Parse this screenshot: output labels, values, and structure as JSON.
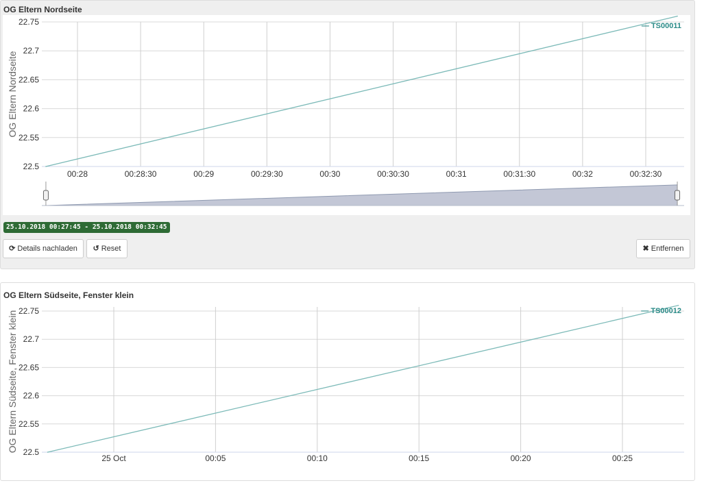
{
  "panels": [
    {
      "title": "OG Eltern Nordseite",
      "range_label": "25.10.2018 00:27:45 - 25.10.2018 00:32:45",
      "buttons": {
        "reload": "Details nachladen",
        "reset": "Reset",
        "remove": "Entfernen"
      }
    },
    {
      "title": "OG Eltern Südseite, Fenster klein"
    }
  ],
  "icons": {
    "reload": "refresh-icon",
    "reset": "undo-icon",
    "remove": "close-icon"
  },
  "colors": {
    "series": "#7cbab8",
    "legend": "#2a8a87",
    "badge": "#2e6b35"
  },
  "chart_data": [
    {
      "type": "line",
      "title": "",
      "ylabel": "OG Eltern Nordseite",
      "xlabel": "",
      "x_ticks": [
        "00:28",
        "00:28:30",
        "00:29",
        "00:29:30",
        "00:30",
        "00:30:30",
        "00:31",
        "00:31:30",
        "00:32",
        "00:32:30"
      ],
      "y_ticks": [
        "22.5",
        "22.55",
        "22.6",
        "22.65",
        "22.7",
        "22.75"
      ],
      "ylim": [
        22.5,
        22.75
      ],
      "legend_position": "top-right",
      "navigator": true,
      "series": [
        {
          "name": "TS00011",
          "x": [
            "00:27:45",
            "00:32:45"
          ],
          "values": [
            22.5,
            22.76
          ]
        }
      ]
    },
    {
      "type": "line",
      "title": "",
      "ylabel": "OG Eltern Südseite, Fenster klein",
      "xlabel": "",
      "x_ticks": [
        "25 Oct",
        "00:05",
        "00:10",
        "00:15",
        "00:20",
        "00:25"
      ],
      "y_ticks": [
        "22.5",
        "22.55",
        "22.6",
        "22.65",
        "22.7",
        "22.75"
      ],
      "ylim": [
        22.5,
        22.75
      ],
      "legend_position": "top-right",
      "series": [
        {
          "name": "TS00012",
          "x": [
            "24 Oct 23:56:45",
            "25 Oct 00:27:45"
          ],
          "values": [
            22.5,
            22.76
          ]
        }
      ]
    }
  ]
}
